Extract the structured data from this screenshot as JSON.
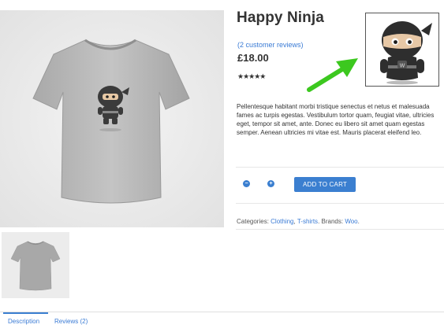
{
  "product": {
    "title": "Happy Ninja",
    "reviews_link": "(2 customer reviews)",
    "price": "£18.00",
    "rating_stars": "★★★★★",
    "rating_value": 5,
    "description": "Pellentesque habitant morbi tristique senectus et netus et malesuada fames ac turpis egestas. Vestibulum tortor quam, feugiat vitae, ultricies eget, tempor sit amet, ante. Donec eu libero sit amet quam egestas semper. Aenean ultricies mi vitae est. Mauris placerat eleifend leo."
  },
  "cart": {
    "qty_minus": "−",
    "qty_plus": "+",
    "qty_value": "",
    "add_label": "ADD TO CART"
  },
  "meta": {
    "categories_label": "Categories:",
    "category_1": "Clothing",
    "separator": ",",
    "category_2": "T-shirts",
    "brands_label": ". Brands:",
    "brand": "Woo",
    "end": "."
  },
  "tabs": {
    "description": "Description",
    "reviews": "Reviews (2)"
  },
  "colors": {
    "accent": "#3b7fd0",
    "link": "#3a7bd5",
    "arrow": "#3cc81f"
  },
  "icons": {
    "qty_minus": "minus-circle-icon",
    "qty_plus": "plus-circle-icon",
    "arrow": "green-arrow-icon"
  }
}
